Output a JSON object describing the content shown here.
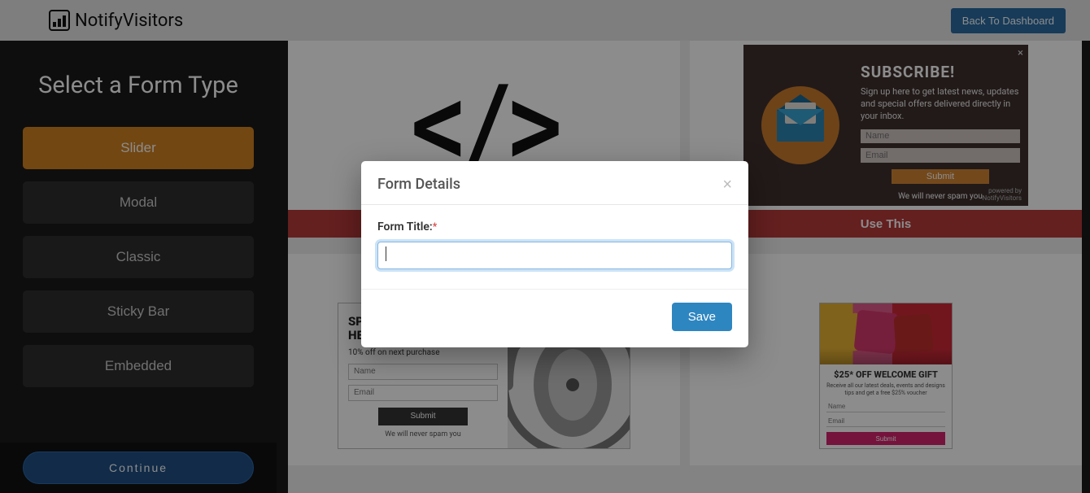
{
  "header": {
    "brand": "NotifyVisitors",
    "back_label": "Back To Dashboard"
  },
  "sidebar": {
    "title": "Select a Form Type",
    "types": [
      "Slider",
      "Modal",
      "Classic",
      "Sticky Bar",
      "Embedded"
    ],
    "active_type": "Slider",
    "continue_label": "Continue"
  },
  "row1": {
    "use_label": "Use This",
    "code_icon_text": "</>",
    "subscribe": {
      "close": "×",
      "title": "SUBSCRIBE!",
      "sub": "Sign up here to get latest news, updates and special offers delivered directly in your inbox.",
      "name_ph": "Name",
      "email_ph": "Email",
      "submit": "Submit",
      "note": "We will never spam you",
      "powered1": "powered by",
      "powered2": "NotifyVisitors"
    }
  },
  "row2": {
    "head": {
      "title": "SPECIAL OFFER ON HEADPHONES",
      "sub": "10% off on next purchase",
      "name_ph": "Name",
      "email_ph": "Email",
      "submit": "Submit",
      "note": "We will never spam you"
    },
    "welcome": {
      "title": "$25* OFF WELCOME GIFT",
      "sub": "Receive all our latest deals, events and designs tips and get a free $25% voucher",
      "name_ph": "Name",
      "email_ph": "Email",
      "submit": "Submit"
    }
  },
  "modal": {
    "title": "Form Details",
    "close": "×",
    "field_label": "Form Title:",
    "required_mark": "*",
    "value": "",
    "save_label": "Save"
  }
}
